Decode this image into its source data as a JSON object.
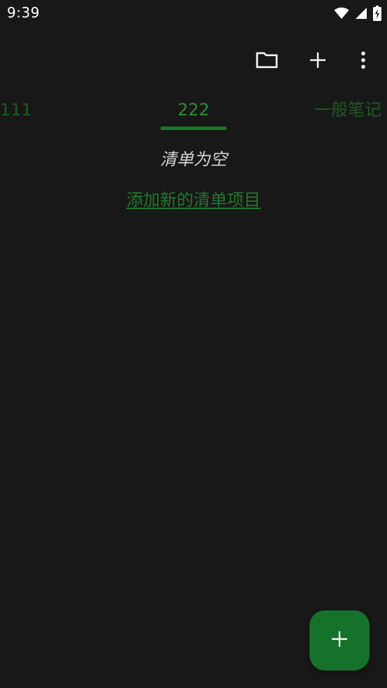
{
  "status_bar": {
    "time": "9:39",
    "icons": [
      "wifi-icon",
      "signal-icon",
      "battery-charging-icon"
    ]
  },
  "toolbar": {
    "actions": [
      "folder-icon",
      "add-icon",
      "more-vertical-icon"
    ]
  },
  "tabs": [
    {
      "label": "111",
      "selected": false
    },
    {
      "label": "222",
      "selected": true
    },
    {
      "label": "一般笔记",
      "selected": false
    }
  ],
  "content": {
    "empty_message": "清单为空",
    "add_item_link": "添加新的清单项目"
  },
  "fab": {
    "icon": "add-icon"
  },
  "colors": {
    "background": "#181818",
    "accent": "#157a26",
    "tab_inactive": "#1f5a23",
    "tab_active": "#2e8b37"
  }
}
